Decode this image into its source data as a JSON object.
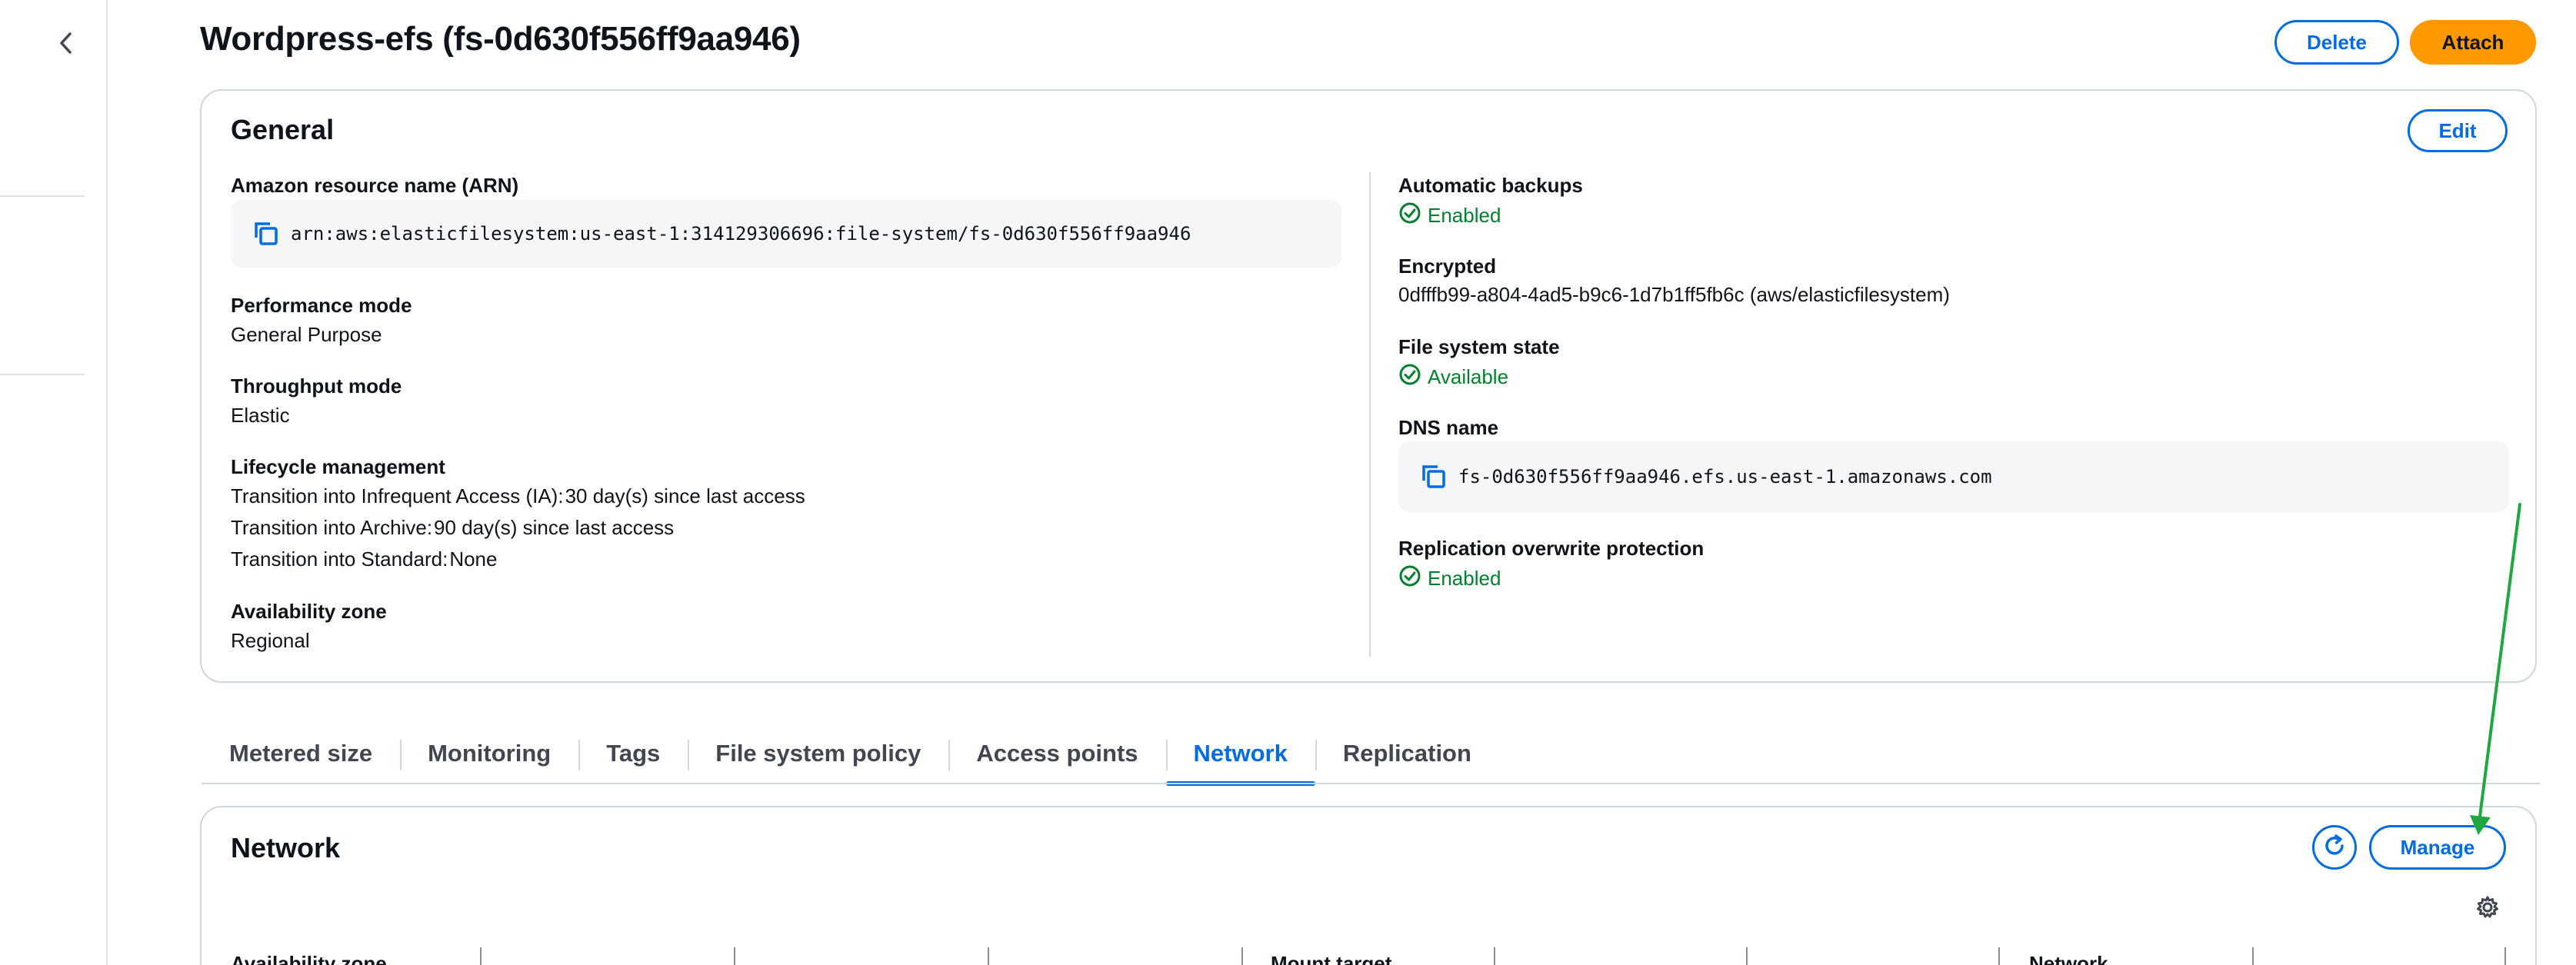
{
  "header": {
    "title": "Wordpress-efs (fs-0d630f556ff9aa946)",
    "delete_label": "Delete",
    "attach_label": "Attach"
  },
  "general": {
    "title": "General",
    "edit_label": "Edit",
    "arn_label": "Amazon resource name (ARN)",
    "arn_value": "arn:aws:elasticfilesystem:us-east-1:314129306696:file-system/fs-0d630f556ff9aa946",
    "performance_label": "Performance mode",
    "performance_value": "General Purpose",
    "throughput_label": "Throughput mode",
    "throughput_value": "Elastic",
    "lifecycle_label": "Lifecycle management",
    "lifecycle_lines": [
      {
        "key": "Transition into Infrequent Access (IA):",
        "value": "30 day(s) since last access"
      },
      {
        "key": "Transition into Archive:",
        "value": "90 day(s) since last access"
      },
      {
        "key": "Transition into Standard:",
        "value": "None"
      }
    ],
    "az_label": "Availability zone",
    "az_value": "Regional",
    "backups_label": "Automatic backups",
    "backups_value": "Enabled",
    "encrypted_label": "Encrypted",
    "encrypted_value": "0dfffb99-a804-4ad5-b9c6-1d7b1ff5fb6c (aws/elasticfilesystem)",
    "state_label": "File system state",
    "state_value": "Available",
    "dns_label": "DNS name",
    "dns_value": "fs-0d630f556ff9aa946.efs.us-east-1.amazonaws.com",
    "replication_label": "Replication overwrite protection",
    "replication_value": "Enabled"
  },
  "tabs": [
    {
      "label": "Metered size"
    },
    {
      "label": "Monitoring"
    },
    {
      "label": "Tags"
    },
    {
      "label": "File system policy"
    },
    {
      "label": "Access points"
    },
    {
      "label": "Network",
      "active": true
    },
    {
      "label": "Replication"
    }
  ],
  "network": {
    "title": "Network",
    "manage_label": "Manage",
    "columns": [
      "Availability zone",
      "Mount target",
      "Network"
    ]
  },
  "colors": {
    "accent": "#006ce0",
    "primary_button": "#ff9900",
    "success": "#00802f",
    "annotation_arrow": "#1fa83f"
  },
  "icons": {
    "back": "chevron-left-icon",
    "copy": "copy-icon",
    "status": "check-circle-icon",
    "refresh": "refresh-icon",
    "settings": "gear-icon"
  }
}
